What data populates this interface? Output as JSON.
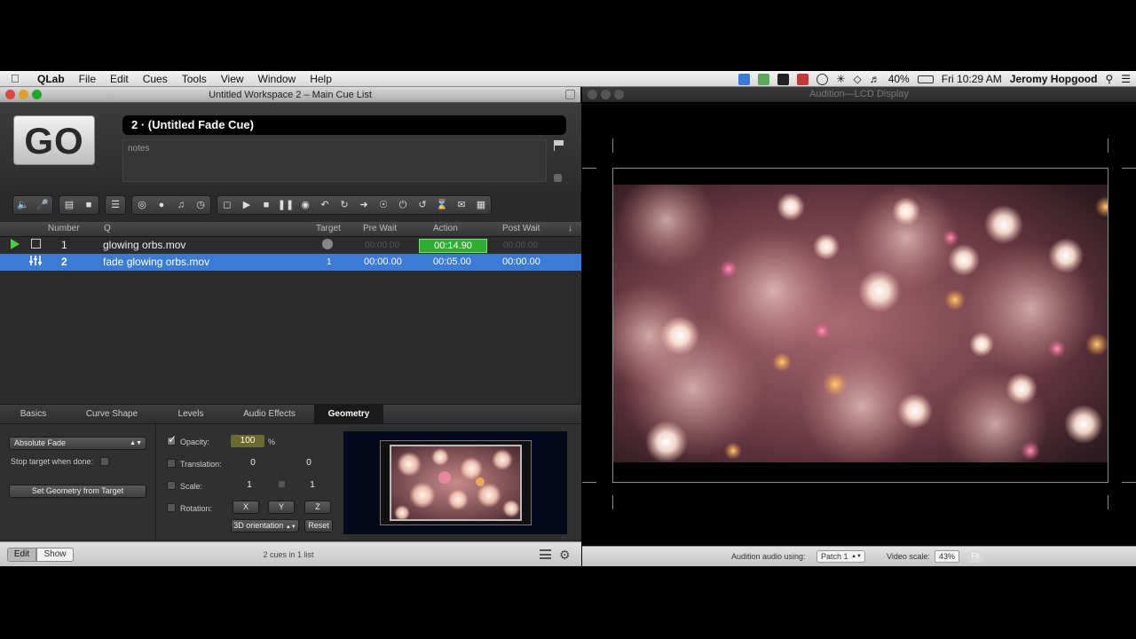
{
  "menubar": {
    "app": "QLab",
    "items": [
      "File",
      "Edit",
      "Cues",
      "Tools",
      "View",
      "Window",
      "Help"
    ],
    "battery": "40%",
    "clock": "Fri 10:29 AM",
    "user": "Jeromy Hopgood"
  },
  "qlab": {
    "title": "Untitled Workspace 2 – Main Cue List",
    "go_label": "GO",
    "cue_name": "2 · (Untitled Fade Cue)",
    "notes_placeholder": "notes",
    "columns": {
      "number": "Number",
      "q": "Q",
      "target": "Target",
      "pre_wait": "Pre Wait",
      "action": "Action",
      "post_wait": "Post Wait"
    },
    "cues": [
      {
        "number": "1",
        "name": "glowing orbs.mov",
        "target": "",
        "pre_wait": "00:00.00",
        "action": "00:14.90",
        "post_wait": "00:00.00"
      },
      {
        "number": "2",
        "name": "fade glowing orbs.mov",
        "target": "1",
        "pre_wait": "00:00.00",
        "action": "00:05.00",
        "post_wait": "00:00.00"
      }
    ],
    "inspector": {
      "tabs": [
        "Basics",
        "Curve Shape",
        "Levels",
        "Audio Effects",
        "Geometry"
      ],
      "active_tab": "Geometry",
      "fade_mode": "Absolute Fade",
      "stop_target_label": "Stop target when done:",
      "set_geometry_label": "Set Geometry from Target",
      "opacity_label": "Opacity:",
      "opacity_value": "100",
      "opacity_unit": "%",
      "translation_label": "Translation:",
      "translation_x": "0",
      "translation_y": "0",
      "scale_label": "Scale:",
      "scale_x": "1",
      "scale_y": "1",
      "rotation_label": "Rotation:",
      "rot_x": "X",
      "rot_y": "Y",
      "rot_z": "Z",
      "orientation_label": "3D orientation",
      "reset_label": "Reset"
    },
    "status": {
      "edit_label": "Edit",
      "show_label": "Show",
      "summary": "2 cues in 1 list"
    }
  },
  "audition": {
    "title": "Audition—LCD Display",
    "audio_label": "Audition audio using:",
    "audio_patch": "Patch 1",
    "scale_label": "Video scale:",
    "scale_value": "43%",
    "fit_label": "Fit"
  },
  "colors": {
    "selection": "#3a7bd5",
    "running": "#2eae2e",
    "go_green": "#3fd13f"
  }
}
